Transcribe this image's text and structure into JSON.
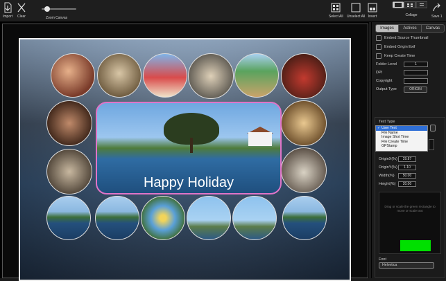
{
  "toolbar": {
    "import_label": "Import",
    "clear_label": "Clear",
    "zoom_label": "Zoom Canvas",
    "zoom_value": 0.15,
    "select_all_label": "Select All",
    "unselect_all_label": "Unselect All",
    "invert_label": "Invert",
    "collage_label": "Collage",
    "save_label": "Save 1"
  },
  "canvas": {
    "caption": "Happy Holiday"
  },
  "panel": {
    "tabs": [
      "Images",
      "Actives",
      "Canvas"
    ],
    "active_tab": "Images",
    "checkboxes": [
      "Embed Source Thumbnail",
      "Embed Origin Exif",
      "Keep Create Time"
    ],
    "folder_level_label": "Folder Level",
    "folder_level_value": "1",
    "dpi_label": "DPI",
    "dpi_value": "",
    "copyright_label": "Copyright",
    "copyright_value": "",
    "output_type_label": "Output Type",
    "output_type_value": "ORIGIN",
    "text_type_label": "Text Type",
    "text_type_options": [
      "User Text",
      "File Name",
      "Image Shot Time",
      "File Create Time",
      "GPStamp"
    ],
    "text_type_selected": "User Text",
    "originx_label": "OriginX(%)",
    "originx_value": "29.87",
    "originy_label": "OriginY(%)",
    "originy_value": "1.10",
    "width_label": "Width(%)",
    "width_value": "50.00",
    "height_label": "Height(%)",
    "height_value": "20.00",
    "preview_hint": "Drag or scale the green rectangle to move or scale text",
    "font_label": "Font",
    "font_value": "Helvetica"
  },
  "colors": {
    "accent": "#2f6fd6",
    "text_rect": "#00e000",
    "frame_border": "#e074c8"
  }
}
